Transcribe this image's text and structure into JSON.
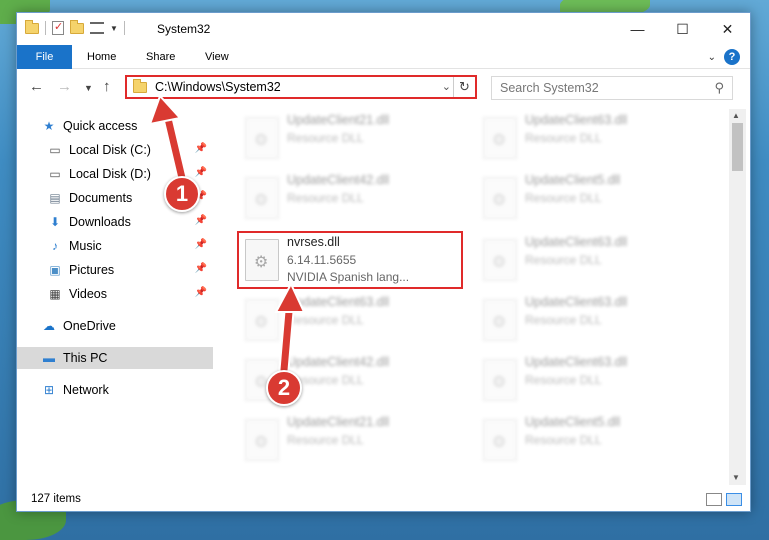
{
  "window": {
    "title": "System32",
    "controls": {
      "minimize": "—",
      "maximize": "☐",
      "close": "✕"
    }
  },
  "ribbon": {
    "tabs": [
      "File",
      "Home",
      "Share",
      "View"
    ],
    "help": "?"
  },
  "address": {
    "path": "C:\\Windows\\System32",
    "search_placeholder": "Search System32"
  },
  "sidebar": {
    "items": [
      {
        "label": "Quick access",
        "icon": "star-icon",
        "pinned": false
      },
      {
        "label": "Local Disk (C:)",
        "icon": "drive-icon",
        "pinned": true
      },
      {
        "label": "Local Disk (D:)",
        "icon": "drive-icon",
        "pinned": true
      },
      {
        "label": "Documents",
        "icon": "documents-icon",
        "pinned": true
      },
      {
        "label": "Downloads",
        "icon": "download-icon",
        "pinned": true
      },
      {
        "label": "Music",
        "icon": "music-icon",
        "pinned": true
      },
      {
        "label": "Pictures",
        "icon": "pictures-icon",
        "pinned": true
      },
      {
        "label": "Videos",
        "icon": "videos-icon",
        "pinned": true
      },
      {
        "label": "OneDrive",
        "icon": "cloud-icon",
        "pinned": false
      },
      {
        "label": "This PC",
        "icon": "pc-icon",
        "pinned": false,
        "selected": true
      },
      {
        "label": "Network",
        "icon": "network-icon",
        "pinned": false
      }
    ]
  },
  "files": {
    "focus": {
      "name": "nvrses.dll",
      "version": "6.14.11.5655",
      "description": "NVIDIA Spanish lang..."
    },
    "left_column": [
      {
        "name": "UpdateClient21.dll",
        "type": "Resource DLL"
      },
      {
        "name": "UpdateClient42.dll",
        "type": "Resource DLL"
      },
      {
        "name": "UpdateClient63.dll",
        "type": "Resource DLL"
      },
      {
        "name": "UpdateClient42.dll",
        "type": "Resource DLL"
      },
      {
        "name": "UpdateClient21.dll",
        "type": "Resource DLL"
      }
    ],
    "right_column": [
      {
        "name": "UpdateClient63.dll",
        "type": "Resource DLL"
      },
      {
        "name": "UpdateClient5.dll",
        "type": "Resource DLL"
      },
      {
        "name": "UpdateClient63.dll",
        "type": "Resource DLL"
      },
      {
        "name": "UpdateClient63.dll",
        "type": "Resource DLL"
      },
      {
        "name": "UpdateClient63.dll",
        "type": "Resource DLL"
      },
      {
        "name": "UpdateClient5.dll",
        "type": "Resource DLL"
      }
    ]
  },
  "status": {
    "item_count": "127 items"
  },
  "annotations": {
    "step1": "1",
    "step2": "2",
    "color": "#d93a32"
  }
}
